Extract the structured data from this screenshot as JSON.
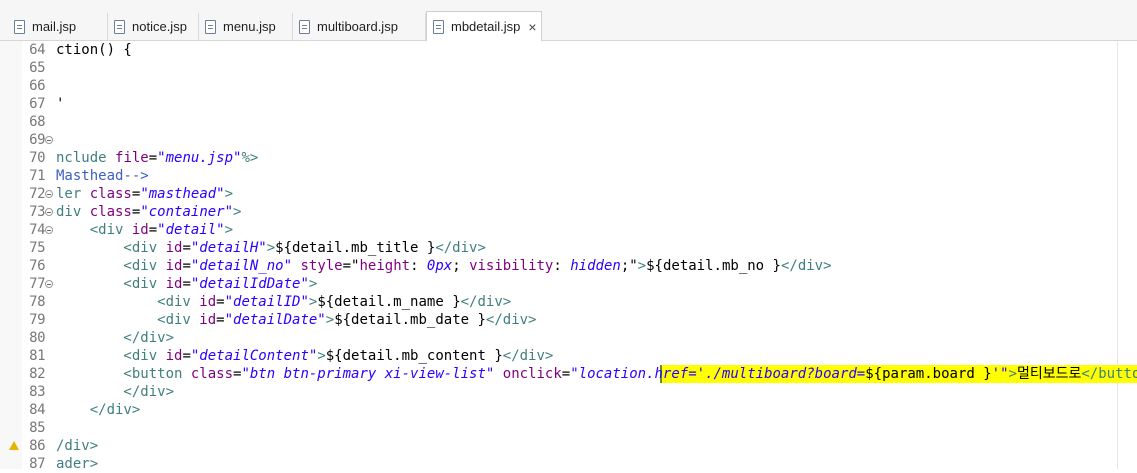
{
  "tabs": [
    {
      "label": "mail.jsp",
      "active": false
    },
    {
      "label": "notice.jsp",
      "active": false
    },
    {
      "label": "menu.jsp",
      "active": false
    },
    {
      "label": "multiboard.jsp",
      "active": false
    },
    {
      "label": "mbdetail.jsp",
      "active": true,
      "close": "×"
    }
  ],
  "editor": {
    "lines": [
      {
        "n": "64",
        "fold": false,
        "warn": false,
        "tokens": [
          {
            "t": "ction() {",
            "c": "txt"
          }
        ]
      },
      {
        "n": "65",
        "fold": false,
        "warn": false,
        "tokens": []
      },
      {
        "n": "66",
        "fold": false,
        "warn": false,
        "tokens": []
      },
      {
        "n": "67",
        "fold": false,
        "warn": false,
        "tokens": [
          {
            "t": "'",
            "c": "txt"
          }
        ]
      },
      {
        "n": "68",
        "fold": false,
        "warn": false,
        "tokens": []
      },
      {
        "n": "69",
        "fold": true,
        "warn": false,
        "tokens": []
      },
      {
        "n": "70",
        "fold": false,
        "warn": false,
        "tokens": [
          {
            "t": "nclude ",
            "c": "tag"
          },
          {
            "t": "file",
            "c": "attr"
          },
          {
            "t": "=",
            "c": "txt"
          },
          {
            "t": "\"menu.jsp\"",
            "c": "str"
          },
          {
            "t": "%>",
            "c": "tag"
          }
        ]
      },
      {
        "n": "71",
        "fold": false,
        "warn": false,
        "tokens": [
          {
            "t": "Masthead-->",
            "c": "cmt"
          }
        ]
      },
      {
        "n": "72",
        "fold": true,
        "warn": false,
        "tokens": [
          {
            "t": "ler ",
            "c": "tag"
          },
          {
            "t": "class",
            "c": "attr"
          },
          {
            "t": "=",
            "c": "txt"
          },
          {
            "t": "\"masthead\"",
            "c": "str"
          },
          {
            "t": ">",
            "c": "tag"
          }
        ]
      },
      {
        "n": "73",
        "fold": true,
        "warn": false,
        "tokens": [
          {
            "t": "div ",
            "c": "tag"
          },
          {
            "t": "class",
            "c": "attr"
          },
          {
            "t": "=",
            "c": "txt"
          },
          {
            "t": "\"container\"",
            "c": "str"
          },
          {
            "t": ">",
            "c": "tag"
          }
        ]
      },
      {
        "n": "74",
        "fold": true,
        "warn": false,
        "tokens": [
          {
            "t": "    <div ",
            "c": "tag"
          },
          {
            "t": "id",
            "c": "attr"
          },
          {
            "t": "=",
            "c": "txt"
          },
          {
            "t": "\"detail\"",
            "c": "str"
          },
          {
            "t": ">",
            "c": "tag"
          }
        ]
      },
      {
        "n": "75",
        "fold": false,
        "warn": false,
        "tokens": [
          {
            "t": "        <div ",
            "c": "tag"
          },
          {
            "t": "id",
            "c": "attr"
          },
          {
            "t": "=",
            "c": "txt"
          },
          {
            "t": "\"detailH\"",
            "c": "str"
          },
          {
            "t": ">",
            "c": "tag"
          },
          {
            "t": "${detail.mb_title }",
            "c": "txt"
          },
          {
            "t": "</div>",
            "c": "tag"
          }
        ]
      },
      {
        "n": "76",
        "fold": false,
        "warn": false,
        "tokens": [
          {
            "t": "        <div ",
            "c": "tag"
          },
          {
            "t": "id",
            "c": "attr"
          },
          {
            "t": "=",
            "c": "txt"
          },
          {
            "t": "\"detailN_no\"",
            "c": "str"
          },
          {
            "t": " ",
            "c": "txt"
          },
          {
            "t": "style",
            "c": "attr"
          },
          {
            "t": "=\"",
            "c": "txt"
          },
          {
            "t": "height",
            "c": "attr"
          },
          {
            "t": ": ",
            "c": "txt"
          },
          {
            "t": "0px",
            "c": "str"
          },
          {
            "t": "; ",
            "c": "txt"
          },
          {
            "t": "visibility",
            "c": "attr"
          },
          {
            "t": ": ",
            "c": "txt"
          },
          {
            "t": "hidden",
            "c": "str"
          },
          {
            "t": ";\"",
            "c": "txt"
          },
          {
            "t": ">",
            "c": "tag"
          },
          {
            "t": "${detail.mb_no }",
            "c": "txt"
          },
          {
            "t": "</div>",
            "c": "tag"
          }
        ]
      },
      {
        "n": "77",
        "fold": true,
        "warn": false,
        "tokens": [
          {
            "t": "        <div ",
            "c": "tag"
          },
          {
            "t": "id",
            "c": "attr"
          },
          {
            "t": "=",
            "c": "txt"
          },
          {
            "t": "\"detailIdDate\"",
            "c": "str"
          },
          {
            "t": ">",
            "c": "tag"
          }
        ]
      },
      {
        "n": "78",
        "fold": false,
        "warn": false,
        "tokens": [
          {
            "t": "            <div ",
            "c": "tag"
          },
          {
            "t": "id",
            "c": "attr"
          },
          {
            "t": "=",
            "c": "txt"
          },
          {
            "t": "\"detailID\"",
            "c": "str"
          },
          {
            "t": ">",
            "c": "tag"
          },
          {
            "t": "${detail.m_name }",
            "c": "txt"
          },
          {
            "t": "</div>",
            "c": "tag"
          }
        ]
      },
      {
        "n": "79",
        "fold": false,
        "warn": false,
        "tokens": [
          {
            "t": "            <div ",
            "c": "tag"
          },
          {
            "t": "id",
            "c": "attr"
          },
          {
            "t": "=",
            "c": "txt"
          },
          {
            "t": "\"detailDate\"",
            "c": "str"
          },
          {
            "t": ">",
            "c": "tag"
          },
          {
            "t": "${detail.mb_date }",
            "c": "txt"
          },
          {
            "t": "</div>",
            "c": "tag"
          }
        ]
      },
      {
        "n": "80",
        "fold": false,
        "warn": false,
        "tokens": [
          {
            "t": "        </div>",
            "c": "tag"
          }
        ]
      },
      {
        "n": "81",
        "fold": false,
        "warn": false,
        "tokens": [
          {
            "t": "        <div ",
            "c": "tag"
          },
          {
            "t": "id",
            "c": "attr"
          },
          {
            "t": "=",
            "c": "txt"
          },
          {
            "t": "\"detailContent\"",
            "c": "str"
          },
          {
            "t": ">",
            "c": "tag"
          },
          {
            "t": "${detail.mb_content }",
            "c": "txt"
          },
          {
            "t": "</div>",
            "c": "tag"
          }
        ]
      },
      {
        "n": "82",
        "fold": false,
        "warn": false,
        "highlight": true,
        "tokens": [
          {
            "t": "        <button ",
            "c": "tag"
          },
          {
            "t": "class",
            "c": "attr"
          },
          {
            "t": "=",
            "c": "txt"
          },
          {
            "t": "\"btn btn-primary xi-view-list\"",
            "c": "str"
          },
          {
            "t": " ",
            "c": "txt"
          },
          {
            "t": "onclick",
            "c": "attr"
          },
          {
            "t": "=",
            "c": "txt"
          },
          {
            "t": "\"location.href='./multiboard?board=",
            "c": "str"
          },
          {
            "t": "${param.board }",
            "c": "txt"
          },
          {
            "t": "'\"",
            "c": "str"
          },
          {
            "t": ">",
            "c": "tag"
          },
          {
            "t": "멀티보드로",
            "c": "txt"
          },
          {
            "t": "</button>",
            "c": "tag"
          }
        ]
      },
      {
        "n": "83",
        "fold": false,
        "warn": false,
        "tokens": [
          {
            "t": "        </div>",
            "c": "tag"
          }
        ]
      },
      {
        "n": "84",
        "fold": false,
        "warn": false,
        "tokens": [
          {
            "t": "    </div>",
            "c": "tag"
          }
        ]
      },
      {
        "n": "85",
        "fold": false,
        "warn": false,
        "tokens": []
      },
      {
        "n": "86",
        "fold": false,
        "warn": true,
        "tokens": [
          {
            "t": "/div>",
            "c": "tag"
          }
        ]
      },
      {
        "n": "87",
        "fold": false,
        "warn": false,
        "tokens": [
          {
            "t": "ader>",
            "c": "tag"
          }
        ]
      }
    ]
  },
  "colors": {
    "tag": "#3f7f7f",
    "attr": "#7f007f",
    "string": "#2a00ff",
    "comment": "#3f5fbf",
    "highlight": "#ffff00"
  }
}
